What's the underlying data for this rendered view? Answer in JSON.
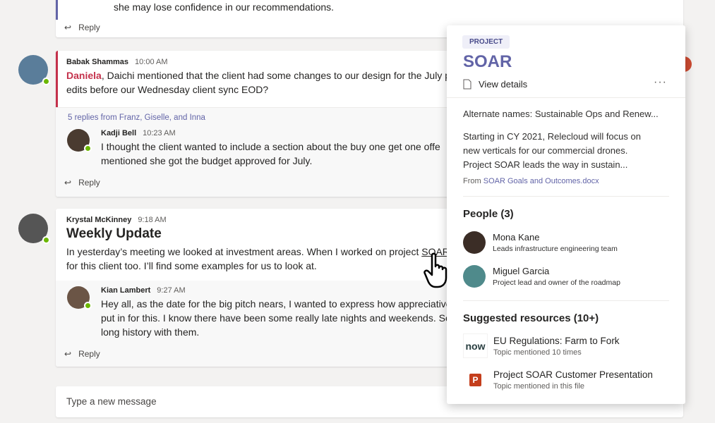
{
  "messages": [
    {
      "text": "she may lose confidence in our recommendations.",
      "reply_label": "Reply"
    },
    {
      "author": "Babak Shammas",
      "time": "10:00 AM",
      "mention": "Daniela",
      "text_line1": ", Daichi mentioned that the client had some changes to our design for the July p",
      "text_line2": "edits before our Wednesday client sync EOD?",
      "replies_summary": "5 replies from Franz, Giselle, and Inna",
      "reply": {
        "author": "Kadji Bell",
        "time": "10:23 AM",
        "line1": "I thought the client wanted to include a section about the buy one get one offe",
        "line2": "mentioned she got the budget approved for July."
      },
      "reply_label": "Reply"
    },
    {
      "author": "Krystal McKinney",
      "time": "9:18 AM",
      "title": "Weekly Update",
      "text_line1_pre": "In yesterday’s meeting we looked at investment areas. When I worked on project ",
      "link": "SOAR",
      "text_line2": "for this client too. I’ll find some examples for us to look at.",
      "reply": {
        "author": "Kian Lambert",
        "time": "9:27 AM",
        "line1": "Hey all, as the date for the big pitch nears, I wanted to express how appreciative",
        "line2": "put in for this. I know there have been some really late nights and weekends. Se",
        "line3": "long history with them."
      },
      "reply_label": "Reply"
    }
  ],
  "compose": {
    "placeholder": "Type a new message"
  },
  "popup": {
    "tag": "PROJECT",
    "title": "SOAR",
    "view_details": "View details",
    "more": "···",
    "alternate_names": "Alternate names: Sustainable Ops and Renew...",
    "description_lines": [
      "Starting in CY 2021, Relecloud will focus on",
      "new verticals for our commercial drones.",
      "Project SOAR leads the way in sustain..."
    ],
    "from_label": "From",
    "from_file": "SOAR Goals and Outcomes.docx",
    "people_heading": "People (3)",
    "people": [
      {
        "name": "Mona Kane",
        "role": "Leads infrastructure engineering team"
      },
      {
        "name": "Miguel Garcia",
        "role": "Project lead and owner of the roadmap"
      }
    ],
    "resources_heading": "Suggested resources (10+)",
    "resources": [
      {
        "icon_text": "now",
        "name": "EU Regulations: Farm to Fork",
        "sub": "Topic mentioned 10 times"
      },
      {
        "icon_text": "P",
        "name": "Project SOAR Customer Presentation",
        "sub": "Topic mentioned in this file"
      }
    ]
  },
  "colors": {
    "accent": "#6264a7",
    "mention": "#c4314b",
    "presence": "#6bb700"
  }
}
